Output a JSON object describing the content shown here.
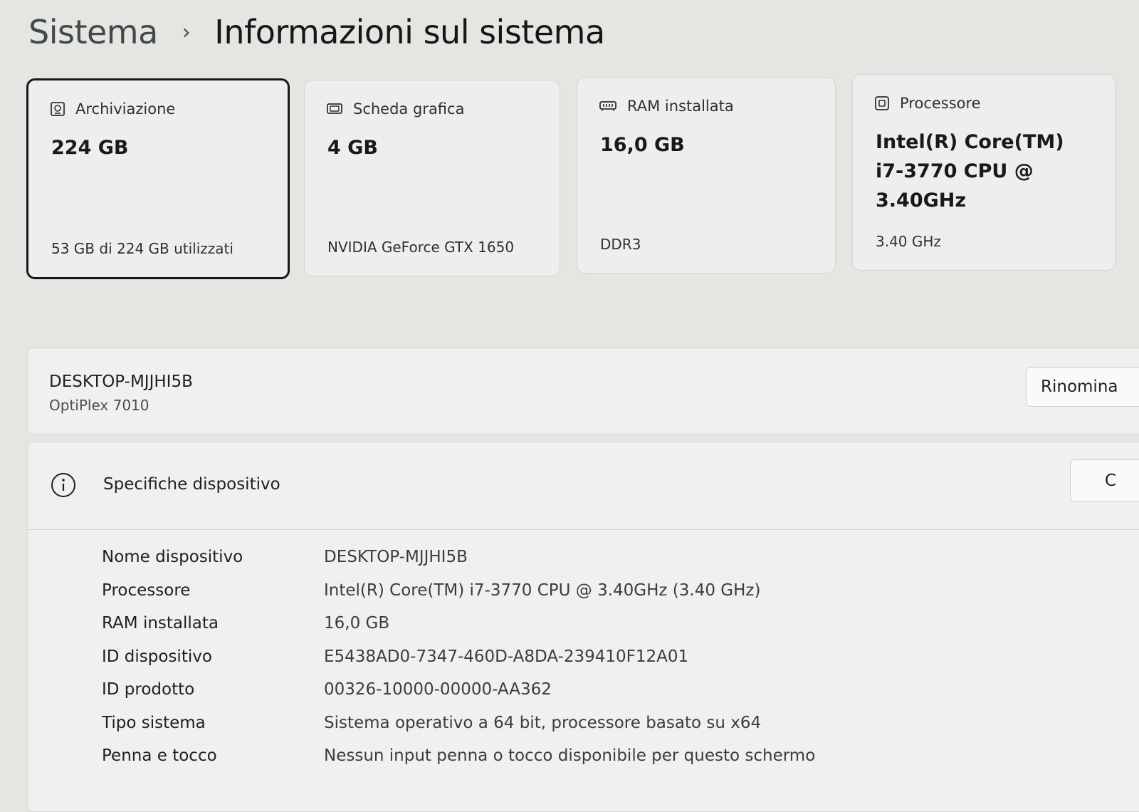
{
  "breadcrumb": {
    "parent": "Sistema",
    "separator": "›",
    "current": "Informazioni sul sistema"
  },
  "cards": [
    {
      "title": "Archiviazione",
      "value": "224 GB",
      "subtitle": "53 GB di 224 GB utilizzati",
      "icon": "storage-icon",
      "selected": true
    },
    {
      "title": "Scheda grafica",
      "value": "4 GB",
      "subtitle": "NVIDIA GeForce GTX 1650",
      "icon": "gpu-icon"
    },
    {
      "title": "RAM installata",
      "value": "16,0 GB",
      "subtitle": "DDR3",
      "icon": "ram-icon"
    },
    {
      "title": "Processore",
      "value": "Intel(R) Core(TM) i7-3770 CPU @ 3.40GHz",
      "subtitle": "3.40 GHz",
      "icon": "cpu-icon"
    }
  ],
  "device": {
    "name": "DESKTOP-MJJHI5B",
    "model": "OptiPlex 7010",
    "rename_label": "Rinomina"
  },
  "specs": {
    "title": "Specifiche dispositivo",
    "icon": "info-icon",
    "copy_label": "C",
    "rows": [
      {
        "label": "Nome dispositivo",
        "value": "DESKTOP-MJJHI5B"
      },
      {
        "label": "Processore",
        "value": "Intel(R) Core(TM) i7-3770 CPU @ 3.40GHz (3.40 GHz)"
      },
      {
        "label": "RAM installata",
        "value": "16,0 GB"
      },
      {
        "label": "ID dispositivo",
        "value": "E5438AD0-7347-460D-A8DA-239410F12A01"
      },
      {
        "label": "ID prodotto",
        "value": "00326-10000-00000-AA362"
      },
      {
        "label": "Tipo sistema",
        "value": "Sistema operativo a 64 bit, processore basato su x64"
      },
      {
        "label": "Penna e tocco",
        "value": "Nessun input penna o tocco disponibile per questo schermo"
      }
    ]
  }
}
